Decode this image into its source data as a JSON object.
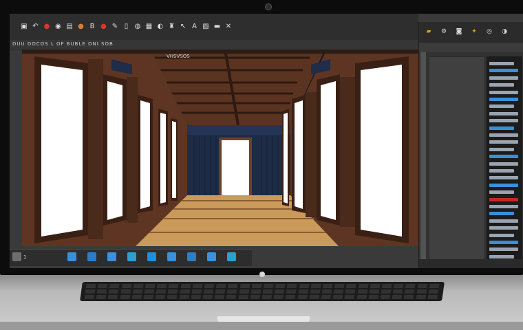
{
  "app": {
    "document_tab": "DUU DOCOS L OF BUBLE ONI SOB",
    "viewport_label": "VHSVSOS"
  },
  "toolbar": {
    "icons": [
      {
        "name": "save-icon",
        "glyph": "▣"
      },
      {
        "name": "undo-icon",
        "glyph": "↶"
      },
      {
        "name": "stop-icon",
        "glyph": "●"
      },
      {
        "name": "select-icon",
        "glyph": "◉"
      },
      {
        "name": "file-icon",
        "glyph": "▤"
      },
      {
        "name": "object-icon",
        "glyph": "●"
      },
      {
        "name": "bold-icon",
        "glyph": "B"
      },
      {
        "name": "record-icon",
        "glyph": "●"
      },
      {
        "name": "tool-icon",
        "glyph": "✎"
      },
      {
        "name": "document-icon",
        "glyph": "▯"
      },
      {
        "name": "sphere-icon",
        "glyph": "◍"
      },
      {
        "name": "lock-icon",
        "glyph": "▦"
      },
      {
        "name": "render-icon",
        "glyph": "◐"
      },
      {
        "name": "bucket-icon",
        "glyph": "♜"
      },
      {
        "name": "cursor-icon",
        "glyph": "↖"
      },
      {
        "name": "text-icon",
        "glyph": "A"
      },
      {
        "name": "image-icon",
        "glyph": "▨"
      },
      {
        "name": "brush-icon",
        "glyph": "▬"
      },
      {
        "name": "close-icon",
        "glyph": "✕"
      }
    ]
  },
  "taskbar": {
    "label": "1",
    "icon_colors": [
      "#3a8fd9",
      "#2d7cc6",
      "#3b91dd",
      "#2a9fd0",
      "#1f8fd8",
      "#3a8fd9",
      "#2d7cc6",
      "#3b91dd",
      "#2a9fd0"
    ]
  },
  "right_panel": {
    "icons": [
      {
        "name": "folder-icon",
        "glyph": "▰"
      },
      {
        "name": "gear-icon",
        "glyph": "⚙"
      },
      {
        "name": "camera-icon",
        "glyph": "◙"
      },
      {
        "name": "light-icon",
        "glyph": "✦"
      },
      {
        "name": "globe-icon",
        "glyph": "◎"
      },
      {
        "name": "palette-icon",
        "glyph": "◑"
      }
    ]
  },
  "colors": {
    "accent_blue": "#3a8fd9",
    "wood": "#6e3f26",
    "floor": "#c99a5a"
  }
}
